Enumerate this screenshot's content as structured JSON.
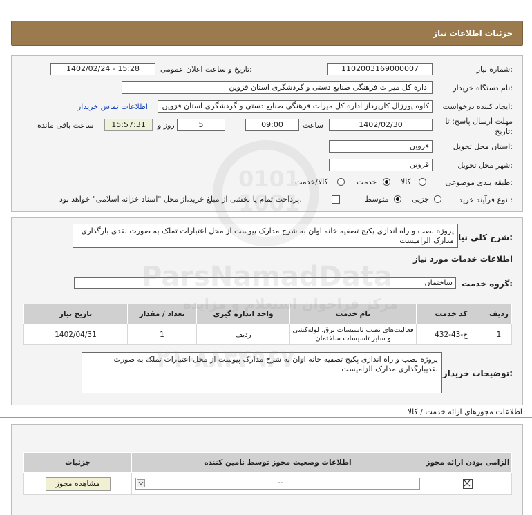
{
  "page": {
    "header_title": "جزئیات اطلاعات نیاز"
  },
  "form": {
    "need_number_label": "شماره نیاز:",
    "need_number": "1102003169000007",
    "announce_label": "تاریخ و ساعت اعلان عمومی:",
    "announce_value": "1402/02/24 - 15:28",
    "buyer_label": "نام دستگاه خریدار:",
    "buyer_value": "اداره کل میراث فرهنگی  صنایع دستی و گردشگری استان قزوین",
    "creator_label": "ایجاد کننده درخواست:",
    "creator_value": "کاوه پورزال کارپرداز اداره کل میراث فرهنگی  صنایع دستی و گردشگری استان قزوین",
    "contact_link": "اطلاعات تماس خریدار",
    "deadline_label": "مهلت ارسال پاسخ: تا",
    "deadline_label2": "تاریخ:",
    "deadline_date": "1402/02/30",
    "time_label": "ساعت",
    "deadline_time": "09:00",
    "days_value": "5",
    "days_label": "روز و",
    "remaining_time": "15:57:31",
    "remaining_label": "ساعت باقی مانده",
    "province_label": "استان محل تحویل:",
    "province_value": "قزوین",
    "city_label": "شهر محل تحویل:",
    "city_value": "قزوین",
    "category_label": "طبقه بندی موضوعی:",
    "category_options": [
      "کالا",
      "خدمت",
      "کالا/خدمت"
    ],
    "category_selected": "خدمت",
    "process_label": "نوع فرآیند خرید :",
    "process_options": [
      "جزیی",
      "متوسط"
    ],
    "process_selected": "متوسط",
    "payment_note": "پرداخت تمام یا بخشی از مبلغ خرید،از محل \"اسناد خزانه اسلامی\" خواهد بود."
  },
  "summary": {
    "label": "شرح کلی نیاز:",
    "text": "پروژه نصب و راه اندازی پکیج تصفیه خانه اوان به شرح مدارک پیوست از محل اعتبارات تملک به صورت نقدی بارگذاری مدارک الزامیست",
    "services_heading": "اطلاعات خدمات مورد نیاز",
    "service_group_label": "گروه خدمت:",
    "service_group_value": "ساختمان"
  },
  "items_table": {
    "headers": [
      "ردیف",
      "کد خدمت",
      "نام خدمت",
      "واحد اندازه گیری",
      "تعداد / مقدار",
      "تاریخ نیاز"
    ],
    "rows": [
      [
        "1",
        "ج-43-432",
        "فعالیت‌های نصب تاسیسات برق، لوله‌کشی و سایر تاسیسات ساختمان",
        "ردیف",
        "1",
        "1402/04/31"
      ]
    ]
  },
  "buyer_notes": {
    "label": "توضیحات خریدار:",
    "text": "پروژه نصب و راه اندازی پکیج تصفیه خانه اوان به شرح مدارک پیوست از محل اعتبارات تملک به صورت نقدیبارگذاری مدارک الزامیست"
  },
  "permits": {
    "heading": "اطلاعات مجوزهای ارائه خدمت / کالا",
    "headers": [
      "الزامی بودن ارائه مجوز",
      "اطلاعات وضعیت مجوز توسط نامین کننده",
      "جزئیات"
    ],
    "status_value": "--",
    "view_button": "مشاهده مجوز"
  },
  "watermark": {
    "line1": "ParsNamadData",
    "line2": "مرکز فراخوان استعلام و مزایده",
    "line3": "۰۲۱-۸۸۳۴۹۶۷۰"
  },
  "colors": {
    "header_bg": "#9b7a4d",
    "panel_bg": "#f4f4f4",
    "table_header_bg": "#d0d0d0",
    "link": "#1a44b8",
    "time_box_bg": "#eef2d8"
  }
}
